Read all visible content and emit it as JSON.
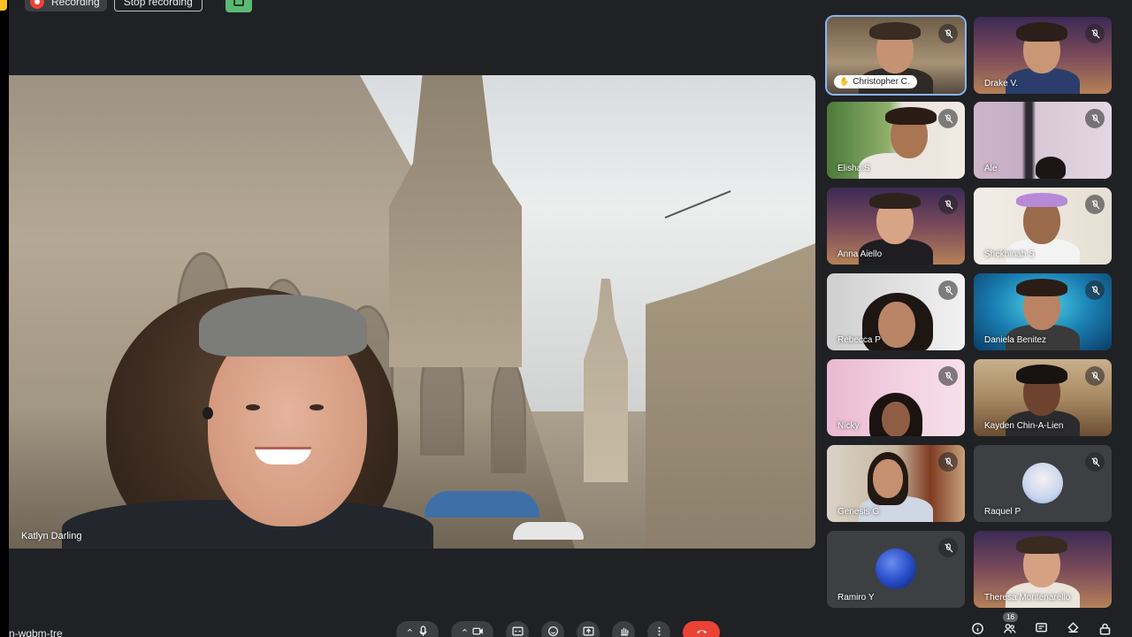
{
  "recording": {
    "label": "Recording",
    "stop_label": "Stop recording"
  },
  "main_speaker": {
    "name": "Katlyn Darling"
  },
  "participants": [
    {
      "name": "Christopher C.",
      "muted": true,
      "active": true,
      "hand_raised": true
    },
    {
      "name": "Drake V.",
      "muted": true
    },
    {
      "name": "Elisha S",
      "muted": true
    },
    {
      "name": "Ale",
      "muted": true
    },
    {
      "name": "Anna Aiello",
      "muted": true
    },
    {
      "name": "Shekhinah S",
      "muted": true
    },
    {
      "name": "Rebecca P",
      "muted": true
    },
    {
      "name": "Daniela Benitez",
      "muted": true
    },
    {
      "name": "Nicky",
      "muted": true
    },
    {
      "name": "Kayden Chin-A-Lien",
      "muted": true
    },
    {
      "name": "Genesis G",
      "muted": true
    },
    {
      "name": "Raquel P",
      "muted": true
    },
    {
      "name": "Ramiro Y",
      "muted": true
    },
    {
      "name": "Theresa Montenarello",
      "muted": false
    }
  ],
  "footer": {
    "meeting_code": "n-wqbm-tre",
    "participant_count": "16"
  },
  "colors": {
    "background": "#202124",
    "accent": "#8ab4f8",
    "end_call": "#ea4335",
    "recording": "#ea4335"
  },
  "icons": [
    "mic-icon",
    "camera-icon",
    "captions-icon",
    "emoji-icon",
    "present-icon",
    "raise-hand-icon",
    "more-icon",
    "end-call-icon",
    "info-icon",
    "people-icon",
    "chat-icon",
    "activities-icon",
    "lock-icon"
  ]
}
